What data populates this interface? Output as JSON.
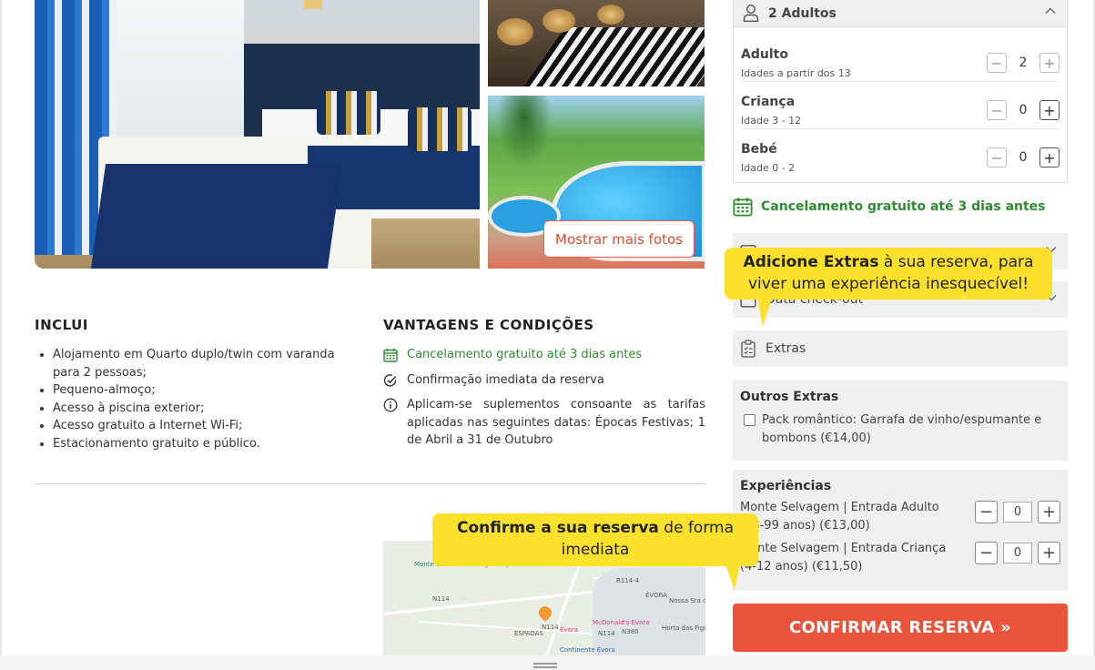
{
  "gallery": {
    "more_photos_label": "Mostrar mais fotos"
  },
  "includes": {
    "title": "INCLUI",
    "items": [
      "Alojamento em Quarto duplo/twin com varanda para 2 pessoas;",
      "Pequeno-almoço;",
      "Acesso à piscina exterior;",
      "Acesso gratuito a Internet Wi-Fi;",
      "Estacionamento gratuito e público."
    ]
  },
  "conditions": {
    "title": "VANTAGENS E CONDIÇÕES",
    "items": [
      {
        "icon": "calendar-icon",
        "text": "Cancelamento gratuito até 3 dias antes"
      },
      {
        "icon": "check-circle-icon",
        "text": "Confirmação imediata da reserva"
      },
      {
        "icon": "info-icon",
        "text": "Aplicam-se suplementos consoante as tarifas aplicadas nas seguintes datas: Épocas Festivas; 1 de Abril a 31 de Outubro"
      }
    ]
  },
  "map": {
    "labels": [
      "Monte da Giesteira Organização de Eventos",
      "N114",
      "N114",
      "ESPADAS",
      "Évora",
      "McDonald's Évora",
      "ÉVORA",
      "Nossa Sra da Saúde",
      "Horta das Figueiras",
      "Continente Évora",
      "R114-4",
      "N380",
      "N114"
    ]
  },
  "booking": {
    "guests_summary": "2 Adultos",
    "guests": [
      {
        "label": "Adulto",
        "sub": "Idades a partir dos 13",
        "value": "2"
      },
      {
        "label": "Criança",
        "sub": "Idade 3 - 12",
        "value": "0"
      },
      {
        "label": "Bebé",
        "sub": "Idade 0 - 2",
        "value": "0"
      }
    ],
    "free_cancel": "Cancelamento gratuito até 3 dias antes",
    "checkout_label": "Data check-out",
    "extras_label": "Extras",
    "other_extras": {
      "title": "Outros Extras",
      "option": "Pack romântico: Garrafa de vinho/espumante e bombons (€14,00)"
    },
    "experiences": {
      "title": "Experiências",
      "items": [
        {
          "label": "Monte Selvagem | Entrada Adulto (13-99 anos) (€13,00)",
          "value": "0"
        },
        {
          "label": "Monte Selvagem | Entrada Criança (4-12 anos) (€11,50)",
          "value": "0"
        }
      ]
    },
    "confirm_label": "CONFIRMAR RESERVA »"
  },
  "tooltips": {
    "extras_bold": "Adicione Extras",
    "extras_rest": " à sua reserva, para viver uma experiência inesquecível!",
    "confirm_bold": "Confirme a sua reserva",
    "confirm_rest": " de forma imediata"
  },
  "colors": {
    "accent": "#e8533a",
    "tooltip": "#fbe12c",
    "success": "#2e8b2e"
  }
}
